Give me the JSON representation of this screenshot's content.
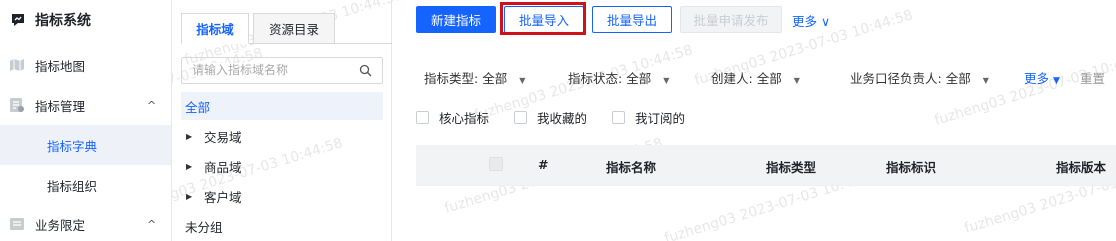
{
  "sidebar": {
    "app_title": "指标系统",
    "items": [
      {
        "label": "指标地图"
      },
      {
        "label": "指标管理",
        "chevron": "^"
      },
      {
        "label": "指标字典"
      },
      {
        "label": "指标组织"
      },
      {
        "label": "业务限定",
        "chevron": "^"
      }
    ]
  },
  "domain_panel": {
    "tabs": [
      "指标域",
      "资源目录"
    ],
    "search_placeholder": "请输入指标域名称",
    "tree": [
      {
        "label": "全部"
      },
      {
        "label": "交易域"
      },
      {
        "label": "商品域"
      },
      {
        "label": "客户域"
      },
      {
        "label": "未分组"
      }
    ]
  },
  "toolbar": {
    "new_label": "新建指标",
    "import_label": "批量导入",
    "export_label": "批量导出",
    "publish_label": "批量申请发布",
    "more_label": "更多 ∨"
  },
  "filters": {
    "type_label": "指标类型:",
    "type_value": "全部",
    "status_label": "指标状态:",
    "status_value": "全部",
    "creator_label": "创建人:",
    "creator_value": "全部",
    "owner_label": "业务口径负责人:",
    "owner_value": "全部",
    "more_label": "更多",
    "reset_label": "重置"
  },
  "checkboxes": [
    "核心指标",
    "我收藏的",
    "我订阅的"
  ],
  "table": {
    "columns": [
      "#",
      "指标名称",
      "指标类型",
      "指标标识",
      "指标版本"
    ]
  },
  "watermark": "fuzheng03 2023-07-03 10:44:58",
  "colors": {
    "accent": "#1664ff",
    "highlight": "#d0111a"
  }
}
